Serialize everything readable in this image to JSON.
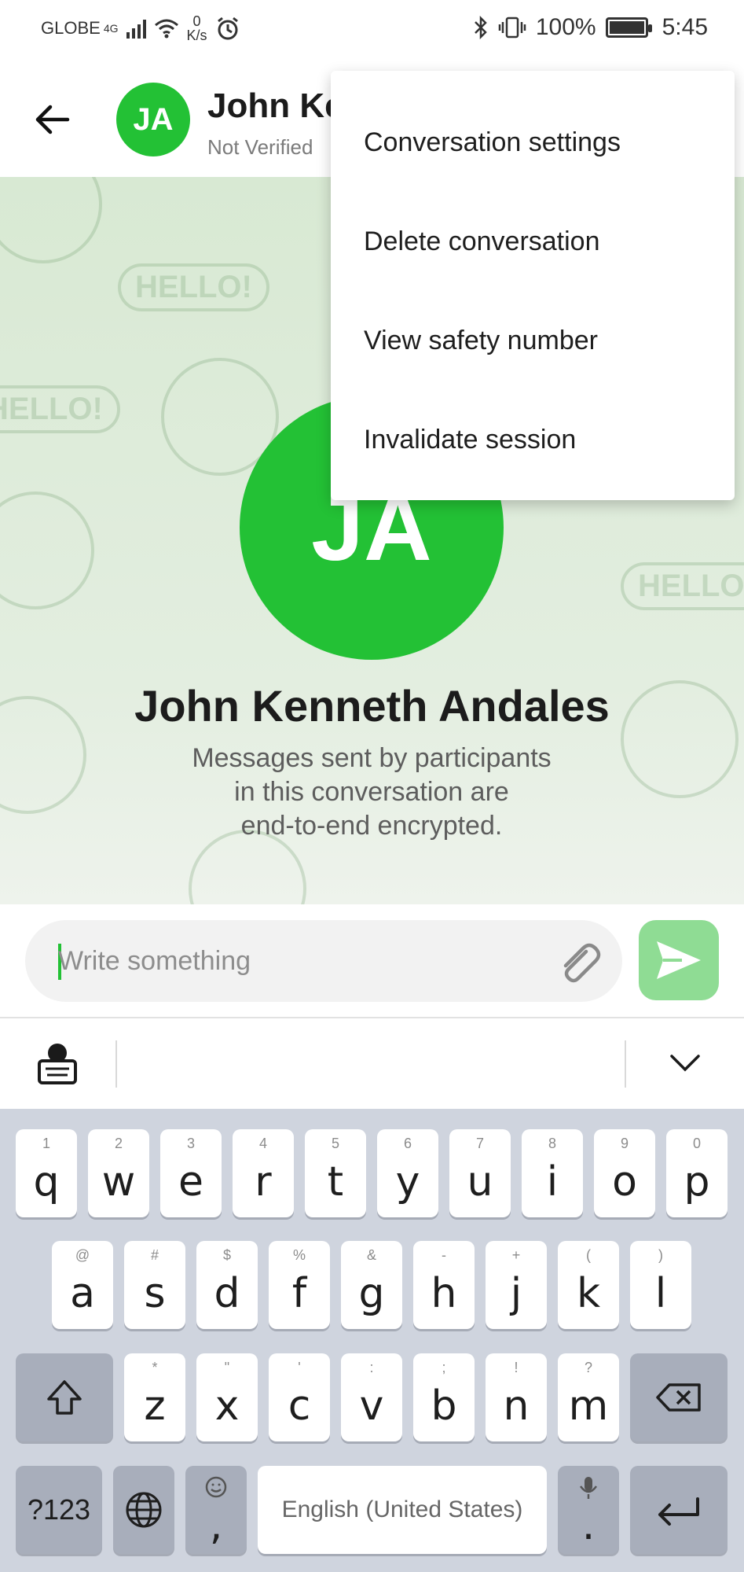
{
  "status_bar": {
    "carrier": "GLOBE",
    "network": "4G",
    "speed_value": "0",
    "speed_unit": "K/s",
    "battery": "100%",
    "time": "5:45"
  },
  "header": {
    "avatar_initials": "JA",
    "name": "John Ke",
    "status": "Not Verified"
  },
  "menu": {
    "items": [
      {
        "label": "Conversation settings"
      },
      {
        "label": "Delete conversation"
      },
      {
        "label": "View safety number"
      },
      {
        "label": "Invalidate session"
      }
    ]
  },
  "chat": {
    "avatar_initials": "JA",
    "contact_name": "John Kenneth Andales",
    "encryption_line1": "Messages sent by participants",
    "encryption_line2": "in this conversation are",
    "encryption_line3": "end-to-end encrypted.",
    "doodle_text": "HELLO!"
  },
  "composer": {
    "placeholder": "Write something"
  },
  "keyboard": {
    "row1": [
      {
        "hint": "1",
        "ch": "q"
      },
      {
        "hint": "2",
        "ch": "w"
      },
      {
        "hint": "3",
        "ch": "e"
      },
      {
        "hint": "4",
        "ch": "r"
      },
      {
        "hint": "5",
        "ch": "t"
      },
      {
        "hint": "6",
        "ch": "y"
      },
      {
        "hint": "7",
        "ch": "u"
      },
      {
        "hint": "8",
        "ch": "i"
      },
      {
        "hint": "9",
        "ch": "o"
      },
      {
        "hint": "0",
        "ch": "p"
      }
    ],
    "row2": [
      {
        "hint": "@",
        "ch": "a"
      },
      {
        "hint": "#",
        "ch": "s"
      },
      {
        "hint": "$",
        "ch": "d"
      },
      {
        "hint": "%",
        "ch": "f"
      },
      {
        "hint": "&",
        "ch": "g"
      },
      {
        "hint": "-",
        "ch": "h"
      },
      {
        "hint": "+",
        "ch": "j"
      },
      {
        "hint": "(",
        "ch": "k"
      },
      {
        "hint": ")",
        "ch": "l"
      }
    ],
    "row3": [
      {
        "hint": "*",
        "ch": "z"
      },
      {
        "hint": "\"",
        "ch": "x"
      },
      {
        "hint": "'",
        "ch": "c"
      },
      {
        "hint": ":",
        "ch": "v"
      },
      {
        "hint": ";",
        "ch": "b"
      },
      {
        "hint": "!",
        "ch": "n"
      },
      {
        "hint": "?",
        "ch": "m"
      }
    ],
    "symbols_label": "?123",
    "comma_key": ",",
    "space_label": "English (United States)",
    "period_key": "."
  },
  "colors": {
    "brand_green": "#23c135",
    "send_button": "#8fdc94",
    "chat_background": "#d8e9d3"
  },
  "icons": [
    "back-arrow-icon",
    "bluetooth-icon",
    "vibrate-icon",
    "battery-icon",
    "alarm-icon",
    "wifi-icon",
    "paperclip-icon",
    "send-icon",
    "keyboard-settings-icon",
    "collapse-keyboard-icon",
    "shift-icon",
    "backspace-icon",
    "globe-icon",
    "emoji-icon",
    "mic-icon",
    "enter-icon"
  ]
}
